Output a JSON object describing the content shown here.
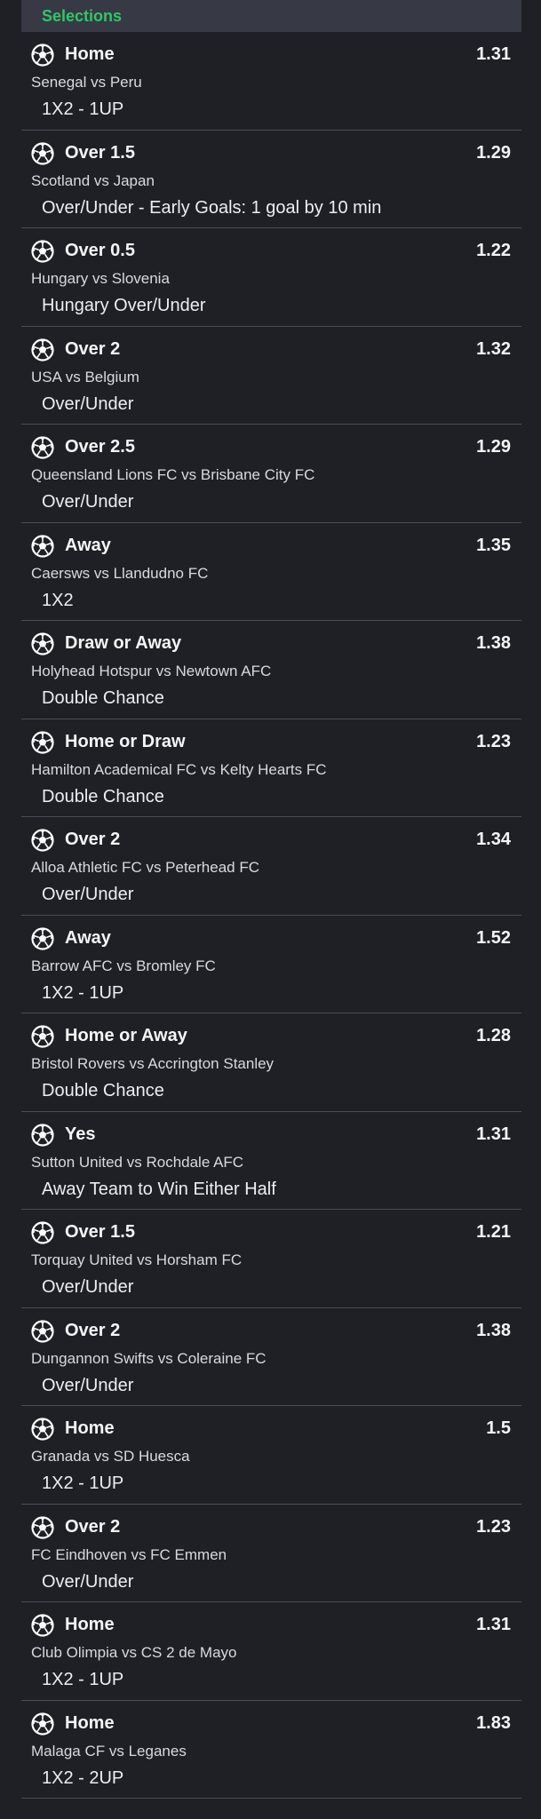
{
  "header": {
    "title": "Selections"
  },
  "colors": {
    "accent": "#2ec866",
    "background": "#1e2026",
    "header_bg": "#373a44"
  },
  "icon": "soccer-ball-icon",
  "selections": [
    {
      "pick": "Home",
      "odds": "1.31",
      "match": "Senegal vs Peru",
      "market": "1X2 - 1UP"
    },
    {
      "pick": "Over 1.5",
      "odds": "1.29",
      "match": "Scotland vs Japan",
      "market": "Over/Under - Early Goals: 1 goal by 10 min"
    },
    {
      "pick": "Over 0.5",
      "odds": "1.22",
      "match": "Hungary vs Slovenia",
      "market": "Hungary Over/Under"
    },
    {
      "pick": "Over 2",
      "odds": "1.32",
      "match": "USA vs Belgium",
      "market": "Over/Under"
    },
    {
      "pick": "Over 2.5",
      "odds": "1.29",
      "match": "Queensland Lions FC vs Brisbane City FC",
      "market": "Over/Under"
    },
    {
      "pick": "Away",
      "odds": "1.35",
      "match": "Caersws vs Llandudno FC",
      "market": "1X2"
    },
    {
      "pick": "Draw or Away",
      "odds": "1.38",
      "match": "Holyhead Hotspur vs Newtown AFC",
      "market": "Double Chance"
    },
    {
      "pick": "Home or Draw",
      "odds": "1.23",
      "match": "Hamilton Academical FC vs Kelty Hearts FC",
      "market": "Double Chance"
    },
    {
      "pick": "Over 2",
      "odds": "1.34",
      "match": "Alloa Athletic FC vs Peterhead FC",
      "market": "Over/Under"
    },
    {
      "pick": "Away",
      "odds": "1.52",
      "match": "Barrow AFC vs Bromley FC",
      "market": "1X2 - 1UP"
    },
    {
      "pick": "Home or Away",
      "odds": "1.28",
      "match": "Bristol Rovers vs Accrington Stanley",
      "market": "Double Chance"
    },
    {
      "pick": "Yes",
      "odds": "1.31",
      "match": "Sutton United vs Rochdale AFC",
      "market": "Away Team to Win Either Half"
    },
    {
      "pick": "Over 1.5",
      "odds": "1.21",
      "match": "Torquay United vs Horsham FC",
      "market": "Over/Under"
    },
    {
      "pick": "Over 2",
      "odds": "1.38",
      "match": "Dungannon Swifts vs Coleraine FC",
      "market": "Over/Under"
    },
    {
      "pick": "Home",
      "odds": "1.5",
      "match": "Granada vs SD Huesca",
      "market": "1X2 - 1UP"
    },
    {
      "pick": "Over 2",
      "odds": "1.23",
      "match": "FC Eindhoven vs FC Emmen",
      "market": "Over/Under"
    },
    {
      "pick": "Home",
      "odds": "1.31",
      "match": "Club Olimpia vs CS 2 de Mayo",
      "market": "1X2 - 1UP"
    },
    {
      "pick": "Home",
      "odds": "1.83",
      "match": "Malaga CF vs Leganes",
      "market": "1X2 - 2UP"
    }
  ]
}
